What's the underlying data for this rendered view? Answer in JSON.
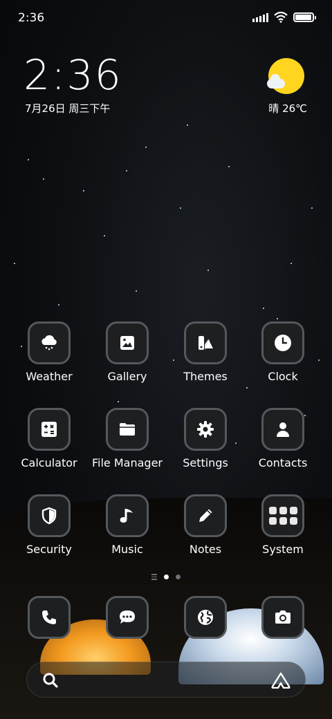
{
  "status_bar": {
    "time": "2:36",
    "battery_level": 0.95
  },
  "clock_widget": {
    "time": "2:36",
    "date": "7月26日 周三下午"
  },
  "weather_widget": {
    "condition": "晴",
    "temperature": "26℃",
    "text": "晴 26℃",
    "icon": "sun-with-cloud-icon"
  },
  "apps": [
    {
      "label": "Weather",
      "icon": "cloud-rain-icon"
    },
    {
      "label": "Gallery",
      "icon": "image-icon"
    },
    {
      "label": "Themes",
      "icon": "palette-icon"
    },
    {
      "label": "Clock",
      "icon": "clock-icon"
    },
    {
      "label": "Calculator",
      "icon": "calculator-icon"
    },
    {
      "label": "File Manager",
      "icon": "folder-icon"
    },
    {
      "label": "Settings",
      "icon": "gear-icon"
    },
    {
      "label": "Contacts",
      "icon": "person-icon"
    },
    {
      "label": "Security",
      "icon": "shield-icon"
    },
    {
      "label": "Music",
      "icon": "music-note-icon"
    },
    {
      "label": "Notes",
      "icon": "pencil-icon"
    },
    {
      "label": "System",
      "icon": "folder-grid-icon"
    }
  ],
  "page_indicator": {
    "pages": 2,
    "current": 1
  },
  "dock": [
    {
      "icon": "phone-icon"
    },
    {
      "icon": "message-icon"
    },
    {
      "icon": "globe-icon"
    },
    {
      "icon": "camera-icon"
    }
  ],
  "search_bar": {
    "left_icon": "search-icon",
    "right_icon": "assistant-icon"
  },
  "colors": {
    "icon_bg": "#1d1f21",
    "icon_border": "#55585c",
    "sun": "#ffd51f"
  }
}
